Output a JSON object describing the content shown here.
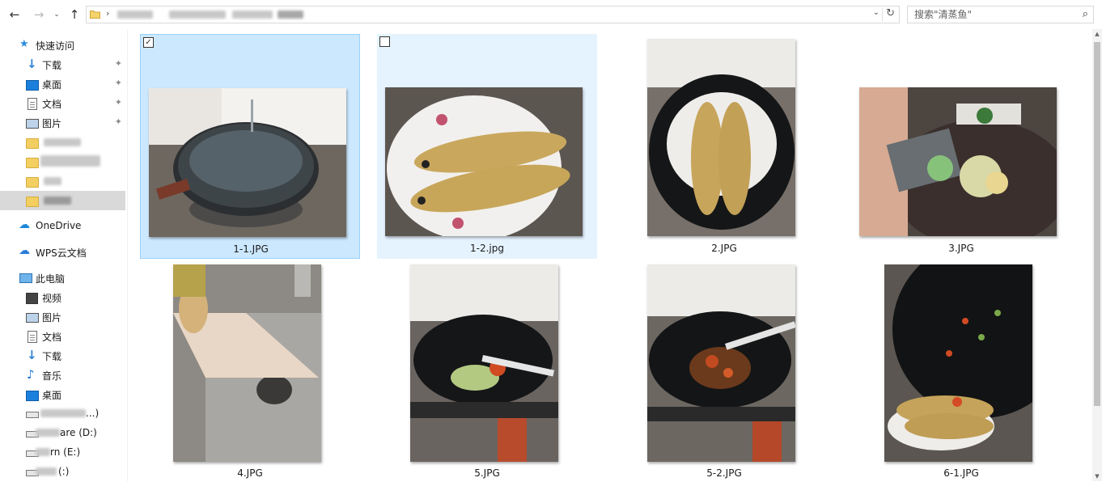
{
  "navigation": {
    "back": "←",
    "forward": "→",
    "recent": "⌄",
    "up": "↑",
    "crumb_separator": "›",
    "path_dropdown": "⌄",
    "refresh": "↻"
  },
  "search": {
    "placeholder": "搜索\"清蒸鱼\"",
    "icon": "⌕"
  },
  "sidebar": {
    "quick_access": "快速访问",
    "pinned": [
      {
        "label": "下载",
        "icon": "download-icon"
      },
      {
        "label": "桌面",
        "icon": "desktop-icon"
      },
      {
        "label": "文档",
        "icon": "document-icon"
      },
      {
        "label": "图片",
        "icon": "pictures-icon"
      }
    ],
    "pin_glyph": "✦",
    "onedrive": "OneDrive",
    "wps": "WPS云文档",
    "this_pc": "此电脑",
    "pc_items": [
      {
        "label": "视频",
        "icon": "video-icon"
      },
      {
        "label": "图片",
        "icon": "pictures-icon"
      },
      {
        "label": "文档",
        "icon": "document-icon"
      },
      {
        "label": "下载",
        "icon": "download-icon"
      },
      {
        "label": "音乐",
        "icon": "music-icon"
      },
      {
        "label": "桌面",
        "icon": "desktop-icon"
      }
    ],
    "drives": [
      {
        "label": "...)"
      },
      {
        "label": "are (D:)"
      },
      {
        "label": "rn (E:)"
      },
      {
        "label": "(:)"
      }
    ]
  },
  "files": [
    {
      "name": "1-1.JPG",
      "checked": true,
      "selected": true
    },
    {
      "name": "1-2.jpg",
      "checked": false,
      "hovered": true
    },
    {
      "name": "2.JPG"
    },
    {
      "name": "3.JPG"
    },
    {
      "name": "4.JPG"
    },
    {
      "name": "5.JPG"
    },
    {
      "name": "5-2.JPG"
    },
    {
      "name": "6-1.JPG"
    }
  ],
  "checkbox": {
    "checked_glyph": "✓",
    "unchecked_glyph": ""
  },
  "scrollbar": {
    "up": "▲",
    "down": "▼"
  }
}
